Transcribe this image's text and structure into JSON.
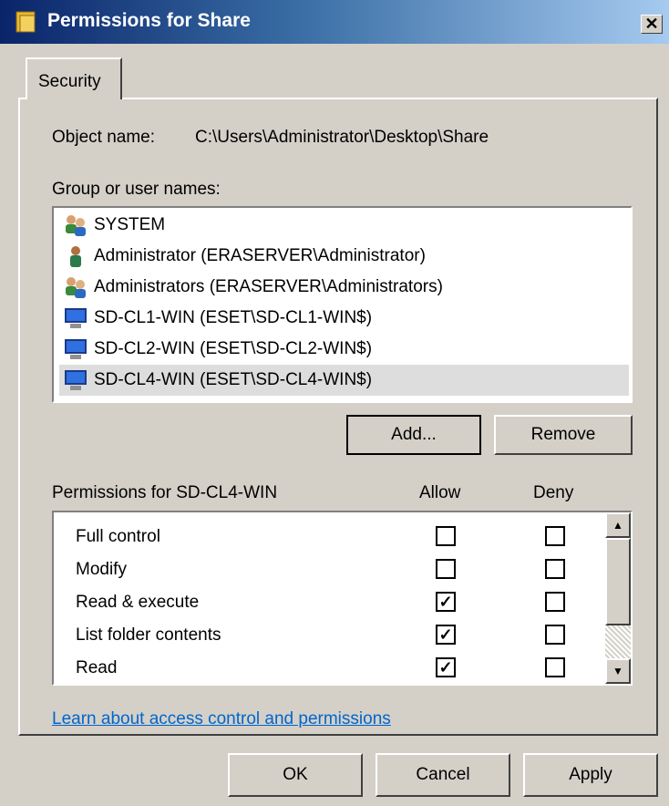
{
  "window": {
    "title": "Permissions for Share",
    "close_glyph": "✕"
  },
  "tabs": [
    {
      "label": "Security",
      "selected": true
    }
  ],
  "object": {
    "label": "Object name:",
    "value": "C:\\Users\\Administrator\\Desktop\\Share"
  },
  "groups": {
    "label": "Group or user names:",
    "items": [
      {
        "label": "SYSTEM",
        "icon": "group-icon"
      },
      {
        "label": "Administrator (ERASERVER\\Administrator)",
        "icon": "user-icon"
      },
      {
        "label": "Administrators (ERASERVER\\Administrators)",
        "icon": "group-icon"
      },
      {
        "label": "SD-CL1-WIN (ESET\\SD-CL1-WIN$)",
        "icon": "computer-icon"
      },
      {
        "label": "SD-CL2-WIN (ESET\\SD-CL2-WIN$)",
        "icon": "computer-icon"
      },
      {
        "label": "SD-CL4-WIN (ESET\\SD-CL4-WIN$)",
        "icon": "computer-icon",
        "selected": true
      }
    ]
  },
  "buttons": {
    "add": "Add...",
    "remove": "Remove",
    "ok": "OK",
    "cancel": "Cancel",
    "apply": "Apply"
  },
  "permissions": {
    "header": "Permissions for SD-CL4-WIN",
    "allow_header": "Allow",
    "deny_header": "Deny",
    "check_glyph": "✓",
    "rows": [
      {
        "name": "Full control",
        "allow": false,
        "deny": false
      },
      {
        "name": "Modify",
        "allow": false,
        "deny": false
      },
      {
        "name": "Read & execute",
        "allow": true,
        "deny": false
      },
      {
        "name": "List folder contents",
        "allow": true,
        "deny": false
      },
      {
        "name": "Read",
        "allow": true,
        "deny": false
      }
    ]
  },
  "link": "Learn about access control and permissions"
}
